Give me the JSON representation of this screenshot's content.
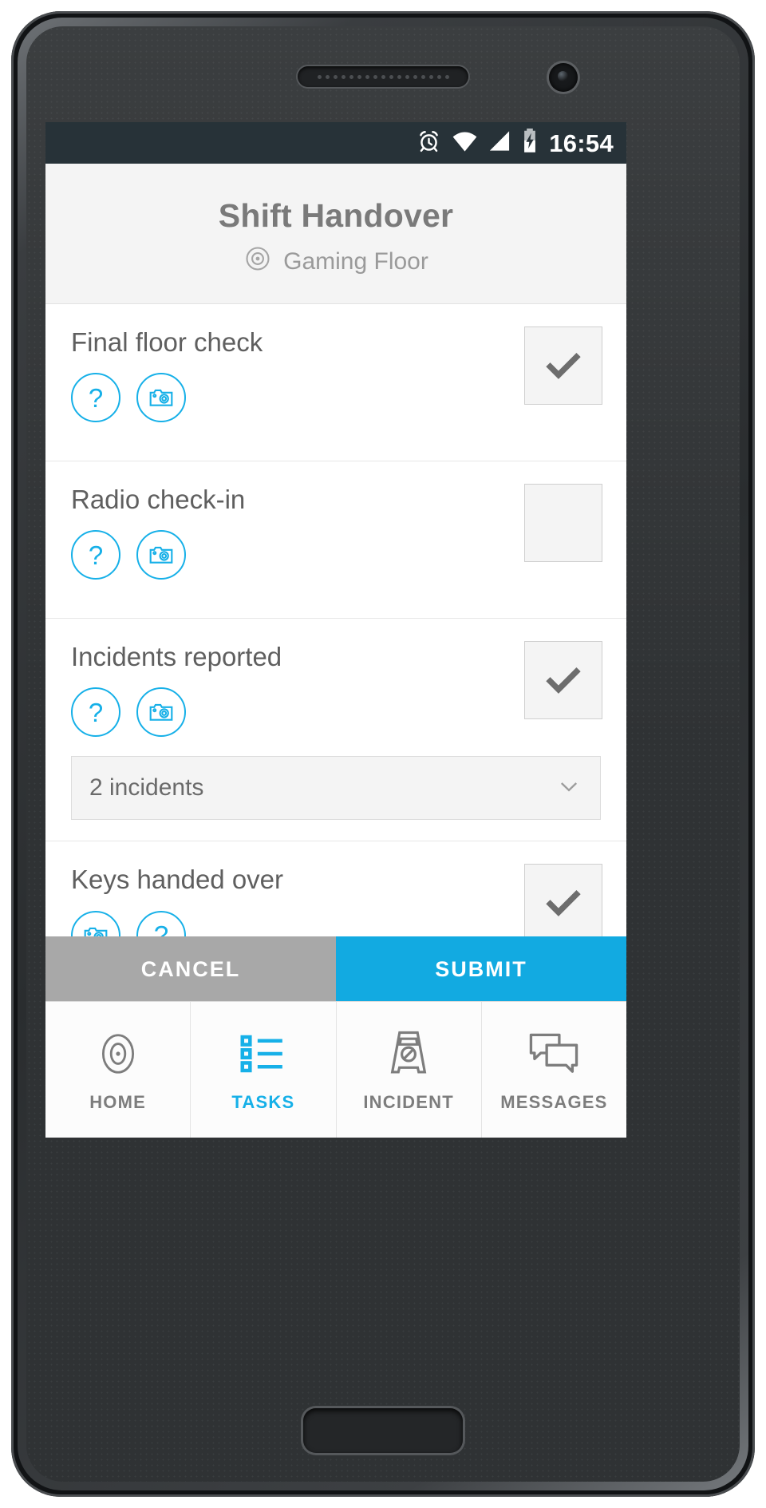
{
  "statusbar": {
    "time": "16:54",
    "icons": [
      "alarm-icon",
      "wifi-icon",
      "signal-icon",
      "battery-charging-icon"
    ]
  },
  "header": {
    "title": "Shift Handover",
    "location_icon": "target-icon",
    "location": "Gaming Floor"
  },
  "tasks": [
    {
      "title": "Final floor check",
      "chips": [
        "help-icon",
        "camera-icon"
      ],
      "checked": true,
      "dropdown": null
    },
    {
      "title": "Radio check-in",
      "chips": [
        "help-icon",
        "camera-icon"
      ],
      "checked": false,
      "dropdown": null
    },
    {
      "title": "Incidents reported",
      "chips": [
        "help-icon",
        "camera-icon"
      ],
      "checked": true,
      "dropdown": {
        "value": "2 incidents",
        "chevron": "chevron-down-icon"
      }
    },
    {
      "title": "Keys handed over",
      "chips": [
        "camera-icon",
        "help-icon"
      ],
      "checked": true,
      "dropdown": null
    }
  ],
  "actions": {
    "cancel_label": "CANCEL",
    "submit_label": "SUBMIT"
  },
  "nav": [
    {
      "label": "HOME",
      "icon": "target-icon",
      "active": false
    },
    {
      "label": "TASKS",
      "icon": "checklist-icon",
      "active": true
    },
    {
      "label": "INCIDENT",
      "icon": "caution-sign-icon",
      "active": false
    },
    {
      "label": "MESSAGES",
      "icon": "chat-bubbles-icon",
      "active": false
    }
  ],
  "colors": {
    "accent": "#16b0e8",
    "submit": "#12aae1",
    "cancel": "#a8a8a8",
    "statusbar": "#273238",
    "text_gray": "#5f5f5f"
  }
}
